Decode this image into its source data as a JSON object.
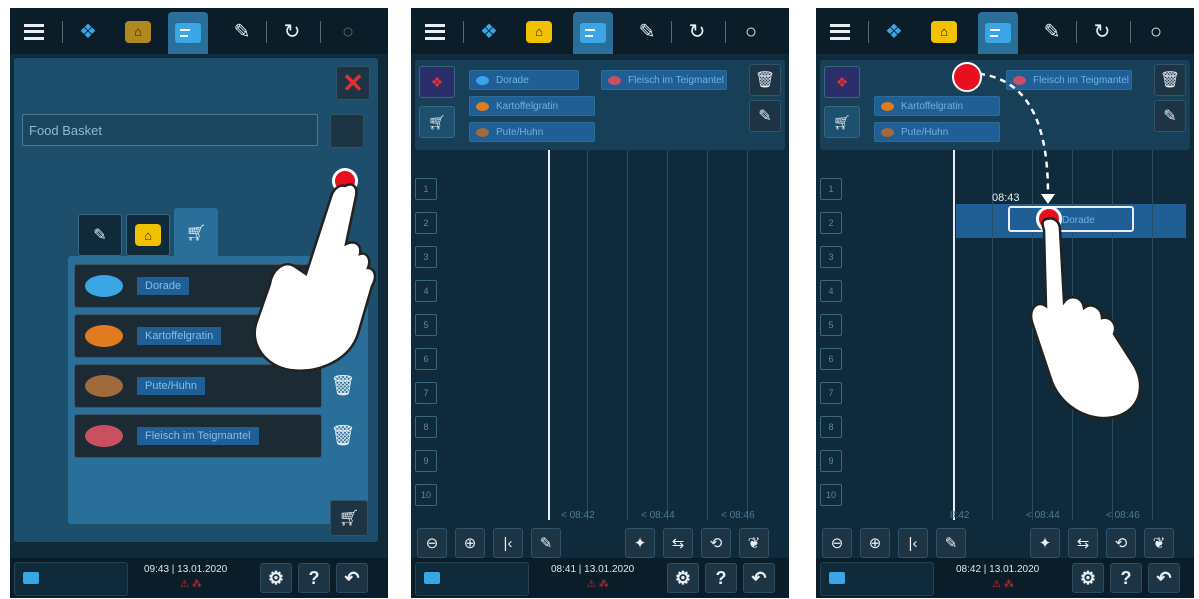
{
  "panels": [
    {
      "topbar": {
        "menu": "menu-icon",
        "icons": [
          "cooking-icon",
          "pot-icon",
          "planner-icon",
          "edit-icon",
          "clean-icon",
          "search-icon"
        ],
        "selected": "planner-icon"
      },
      "dialog": {
        "close_label": "✕",
        "name_field": "Food Basket",
        "tabs": [
          "edit-icon",
          "pot-icon",
          "basket-icon"
        ],
        "items": [
          {
            "label": "Dorade",
            "pic": "fish-icon",
            "color": "#3aa6e6"
          },
          {
            "label": "Kartoffelgratin",
            "pic": "vegetable-icon",
            "color": "#e07b20"
          },
          {
            "label": "Pute/Huhn",
            "pic": "poultry-icon",
            "color": "#a06a3a"
          },
          {
            "label": "Fleisch im Teigmantel",
            "pic": "meat-icon",
            "color": "#c85060"
          }
        ]
      },
      "bottombar": {
        "time": "09:43 | 13.01.2020",
        "status": "⚠ ⁂"
      }
    },
    {
      "topbar": {
        "selected": "planner-icon"
      },
      "tray": {
        "chips": [
          {
            "label": "Dorade",
            "color": "#3aa6e6"
          },
          {
            "label": "Fleisch im Teigmantel",
            "color": "#c85060"
          },
          {
            "label": "Kartoffelgratin",
            "color": "#e07b20"
          },
          {
            "label": "Pute/Huhn",
            "color": "#a06a3a"
          }
        ]
      },
      "rows": [
        "1",
        "2",
        "3",
        "4",
        "5",
        "6",
        "7",
        "8",
        "9",
        "10"
      ],
      "ticks": [
        "< 08:42",
        "< 08:44",
        "< 08:46"
      ],
      "bottombar": {
        "time": "08:41 | 13.01.2020",
        "status": "⚠ ⁂"
      }
    },
    {
      "topbar": {
        "selected": "planner-icon"
      },
      "tray": {
        "chips": [
          {
            "label": "Fleisch im Teigmantel",
            "color": "#c85060"
          },
          {
            "label": "Kartoffelgratin",
            "color": "#e07b20"
          },
          {
            "label": "Pute/Huhn",
            "color": "#a06a3a"
          }
        ]
      },
      "rows": [
        "1",
        "2",
        "3",
        "4",
        "5",
        "6",
        "7",
        "8",
        "9",
        "10"
      ],
      "slot_time": "08:43",
      "slot_label": "Dorade",
      "ticks": [
        "8:42",
        "< 08:44",
        "< 08:46"
      ],
      "bottombar": {
        "time": "08:42 | 13.01.2020",
        "status": "⚠ ⁂"
      }
    }
  ]
}
